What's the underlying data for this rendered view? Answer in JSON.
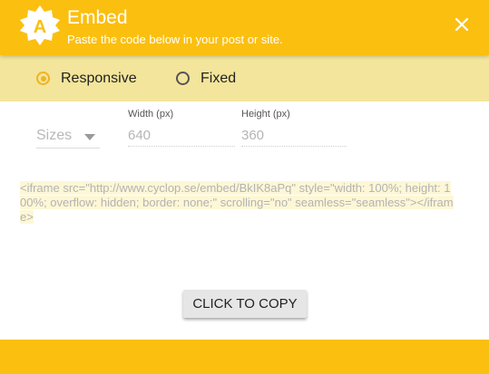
{
  "header": {
    "logo_letter": "A",
    "title": "Embed",
    "subtitle": "Paste the code below in your post or site."
  },
  "mode": {
    "options": [
      {
        "label": "Responsive",
        "selected": true
      },
      {
        "label": "Fixed",
        "selected": false
      }
    ]
  },
  "size": {
    "select_value": "Sizes",
    "width_label": "Width (px)",
    "width_value": "640",
    "height_label": "Height (px)",
    "height_value": "360"
  },
  "embed": {
    "code": "<iframe src=\"http://www.cyclop.se/embed/BkIK8aPq\" style=\"width: 100%; height: 100%; overflow: hidden; border: none;\" scrolling=\"no\" seamless=\"seamless\"></iframe>"
  },
  "actions": {
    "copy_label": "CLICK TO COPY"
  },
  "colors": {
    "header": "#fbbf10",
    "radio_bar": "#f3e59b",
    "radio_selected": "#f0b323"
  }
}
